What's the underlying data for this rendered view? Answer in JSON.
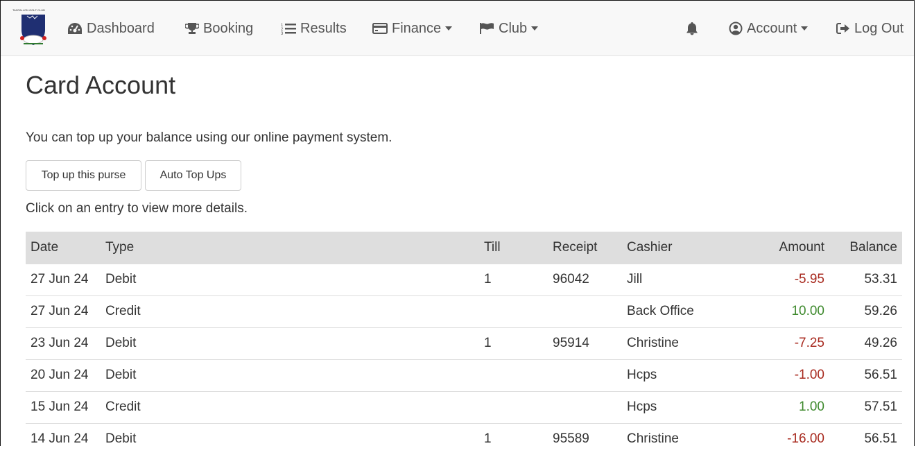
{
  "nav": {
    "logo_text": "TANTALLON GOLF CLUB",
    "items": [
      {
        "label": "Dashboard",
        "icon": "tachometer-icon"
      },
      {
        "label": "Booking",
        "icon": "trophy-icon"
      },
      {
        "label": "Results",
        "icon": "list-ol-icon"
      },
      {
        "label": "Finance",
        "icon": "credit-card-icon",
        "dropdown": true
      },
      {
        "label": "Club",
        "icon": "flag-icon",
        "dropdown": true
      }
    ],
    "right": [
      {
        "label": "",
        "icon": "bell-icon"
      },
      {
        "label": "Account",
        "icon": "user-circle-icon",
        "dropdown": true
      },
      {
        "label": "Log Out",
        "icon": "sign-out-icon"
      }
    ]
  },
  "page": {
    "title": "Card Account",
    "intro": "You can top up your balance using our online payment system.",
    "buttons": {
      "top_up": "Top up this purse",
      "auto_top_ups": "Auto Top Ups"
    },
    "hint": "Click on an entry to view more details."
  },
  "table": {
    "headers": [
      "Date",
      "Type",
      "Till",
      "Receipt",
      "Cashier",
      "Amount",
      "Balance"
    ],
    "rows": [
      {
        "date": "27 Jun 24",
        "type": "Debit",
        "till": "1",
        "receipt": "96042",
        "cashier": "Jill",
        "amount": "-5.95",
        "balance": "53.31"
      },
      {
        "date": "27 Jun 24",
        "type": "Credit",
        "till": "",
        "receipt": "",
        "cashier": "Back Office",
        "amount": "10.00",
        "balance": "59.26"
      },
      {
        "date": "23 Jun 24",
        "type": "Debit",
        "till": "1",
        "receipt": "95914",
        "cashier": "Christine",
        "amount": "-7.25",
        "balance": "49.26"
      },
      {
        "date": "20 Jun 24",
        "type": "Debit",
        "till": "",
        "receipt": "",
        "cashier": "Hcps",
        "amount": "-1.00",
        "balance": "56.51"
      },
      {
        "date": "15 Jun 24",
        "type": "Credit",
        "till": "",
        "receipt": "",
        "cashier": "Hcps",
        "amount": "1.00",
        "balance": "57.51"
      },
      {
        "date": "14 Jun 24",
        "type": "Debit",
        "till": "1",
        "receipt": "95589",
        "cashier": "Christine",
        "amount": "-16.00",
        "balance": "56.51"
      }
    ]
  },
  "colors": {
    "debit": "#a82a1f",
    "credit": "#3f8a2e",
    "header_bg": "#dedede",
    "navbar_bg": "#f8f8f8"
  }
}
